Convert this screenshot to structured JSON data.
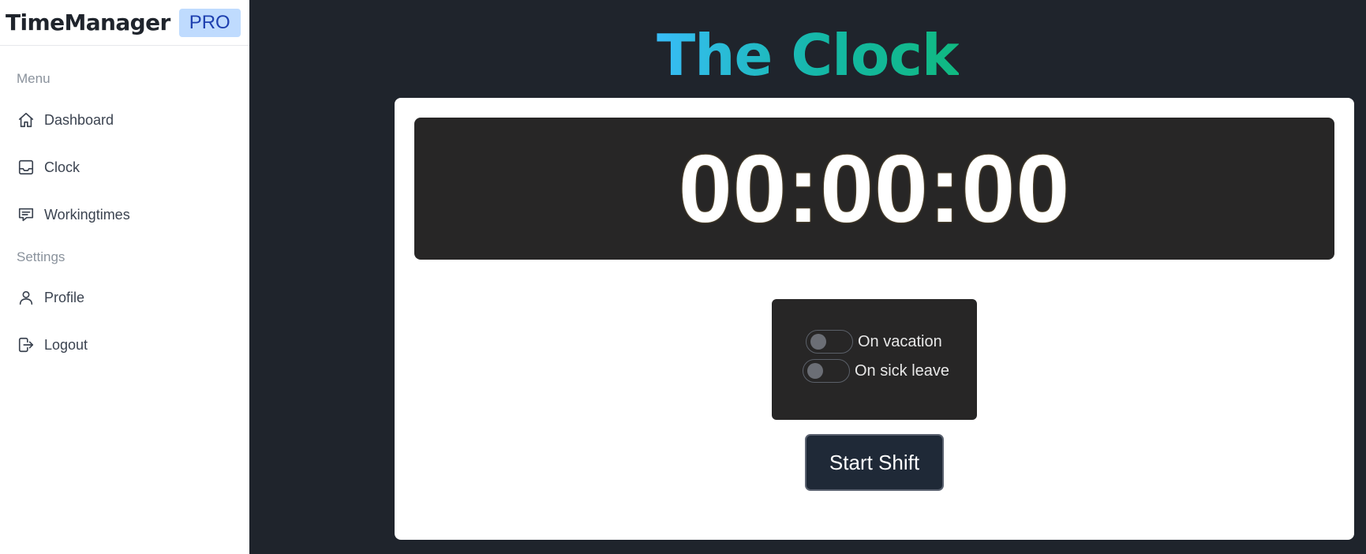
{
  "sidebar": {
    "brand_name": "TimeManager",
    "brand_badge": "PRO",
    "menu_label": "Menu",
    "settings_label": "Settings",
    "menu_items": [
      {
        "label": "Dashboard",
        "icon": "home-icon"
      },
      {
        "label": "Clock",
        "icon": "inbox-icon"
      },
      {
        "label": "Workingtimes",
        "icon": "chat-icon"
      }
    ],
    "settings_items": [
      {
        "label": "Profile",
        "icon": "user-icon"
      },
      {
        "label": "Logout",
        "icon": "logout-icon"
      }
    ]
  },
  "main": {
    "title": "The Clock",
    "timer": "00:00:00",
    "toggles": [
      {
        "label": "On vacation",
        "checked": false
      },
      {
        "label": "On sick leave",
        "checked": false
      }
    ],
    "start_button_label": "Start Shift"
  },
  "colors": {
    "background": "#1f242c",
    "title_gradient_start": "#38bdf8",
    "title_gradient_end": "#10b981",
    "badge_bg": "#bfdbfe",
    "badge_text": "#1e40af",
    "button_bg": "#1f2937"
  }
}
